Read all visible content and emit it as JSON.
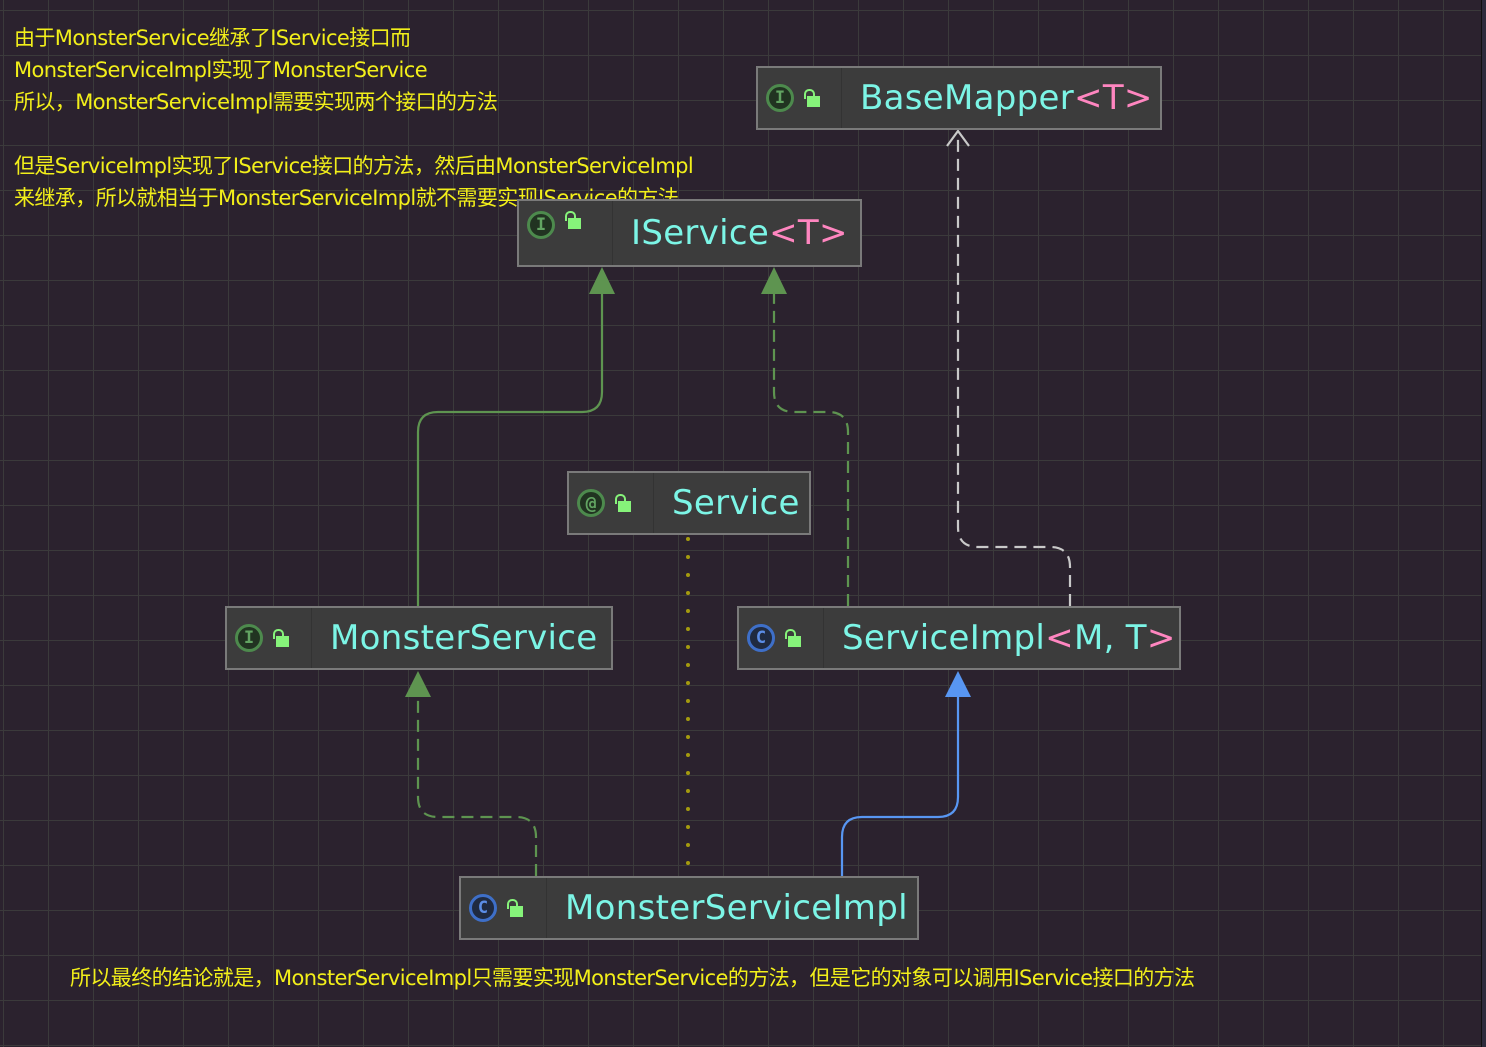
{
  "colors": {
    "background": "#2b222e",
    "grid": "#3b3a3b",
    "note_text": "#f2ef1a",
    "node_title": "#7cf5e6",
    "generic_param": "#ff86c0",
    "extends_interface_edge": "#5e9450",
    "implements_edge": "#5e9450",
    "class_extends_edge": "#5896f2",
    "basemapper_edge": "#c9c9c9",
    "annotation_edge": "#a59b0e"
  },
  "notes": {
    "top_block": {
      "lines": [
        "由于MonsterService继承了IService接口而",
        "MonsterServiceImpl实现了MonsterService",
        "所以，MonsterServiceImpl需要实现两个接口的方法",
        "",
        "但是ServiceImpl实现了IService接口的方法，然后由MonsterServiceImpl",
        "来继承，所以就相当于MonsterServiceImpl就不需要实现IService的方法"
      ]
    },
    "bottom": "所以最终的结论就是，MonsterServiceImpl只需要实现MonsterService的方法，但是它的对象可以调用IService接口的方法"
  },
  "nodes": {
    "basemapper": {
      "name": "BaseMapper",
      "generic": "<T>",
      "kind": "interface",
      "kind_icon": "I",
      "visibility": "public"
    },
    "iservice": {
      "name": "IService",
      "generic": "<T>",
      "kind": "interface",
      "kind_icon": "I",
      "visibility": "public"
    },
    "service": {
      "name": "Service",
      "generic": "",
      "kind": "annotation",
      "kind_icon": "@",
      "visibility": "public"
    },
    "monsterservice": {
      "name": "MonsterService",
      "generic": "",
      "kind": "interface",
      "kind_icon": "I",
      "visibility": "public"
    },
    "serviceimpl": {
      "name": "ServiceImpl",
      "generic_open": "<",
      "generic_params": "M, T",
      "generic_close": ">",
      "kind": "class",
      "kind_icon": "C",
      "visibility": "public"
    },
    "monsterserviceimpl": {
      "name": "MonsterServiceImpl",
      "generic": "",
      "kind": "class",
      "kind_icon": "C",
      "visibility": "public"
    }
  },
  "edges": [
    {
      "from": "MonsterService",
      "to": "IService",
      "type": "extends",
      "style": "solid",
      "color": "#5e9450"
    },
    {
      "from": "ServiceImpl",
      "to": "IService",
      "type": "implements",
      "style": "dashed",
      "color": "#5e9450"
    },
    {
      "from": "ServiceImpl",
      "to": "BaseMapper",
      "type": "uses",
      "style": "dashed",
      "color": "#c9c9c9"
    },
    {
      "from": "MonsterServiceImpl",
      "to": "MonsterService",
      "type": "implements",
      "style": "dashed",
      "color": "#5e9450"
    },
    {
      "from": "MonsterServiceImpl",
      "to": "ServiceImpl",
      "type": "extends",
      "style": "solid",
      "color": "#5896f2"
    },
    {
      "from": "MonsterServiceImpl",
      "to": "Service",
      "type": "annotated-with",
      "style": "dotted",
      "color": "#a59b0e"
    }
  ]
}
